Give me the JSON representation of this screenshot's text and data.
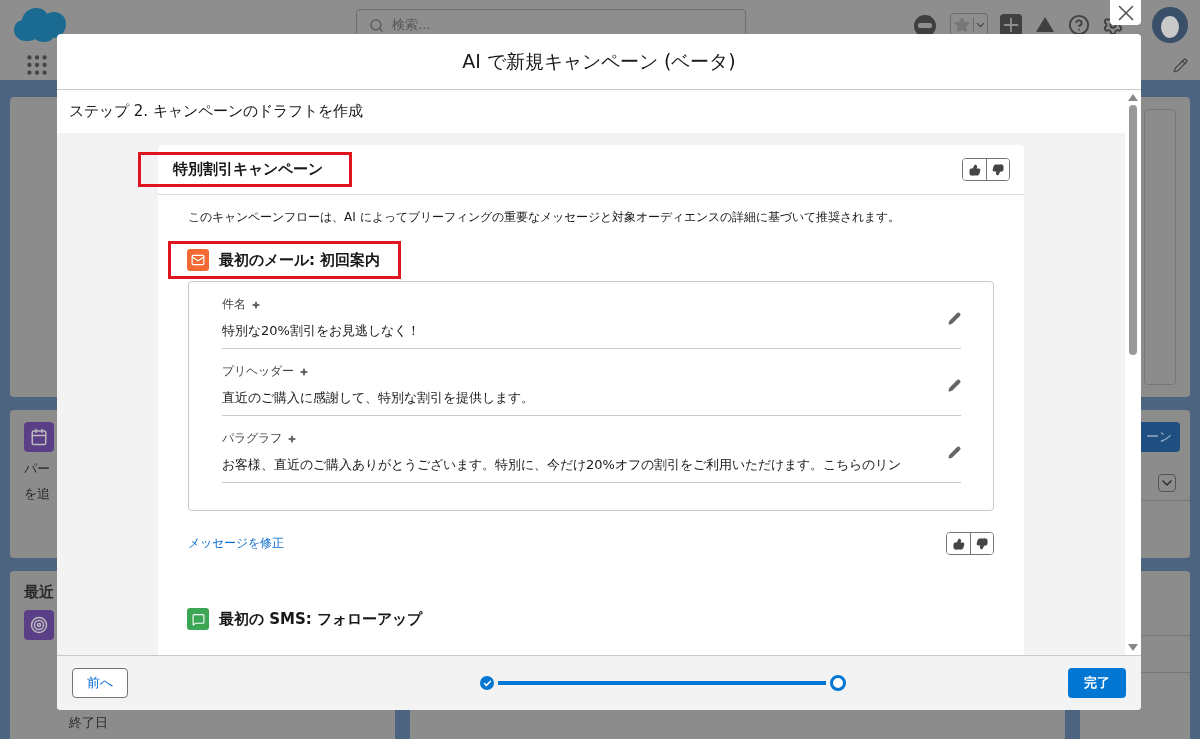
{
  "background": {
    "search": {
      "placeholder": "検索..."
    },
    "left_cards": [
      {
        "kind": "empty"
      },
      {
        "kind": "text",
        "lines": [
          "パー",
          "を追"
        ]
      },
      {
        "kind": "list",
        "title": "最近",
        "footer": "終了日"
      }
    ],
    "right_cards": [
      {
        "kind": "box"
      },
      {
        "kind": "button",
        "button": "ーン"
      },
      {
        "kind": "lines"
      }
    ]
  },
  "modal": {
    "title": "AI で新規キャンペーン (ベータ)",
    "step": "ステップ 2. キャンペーンのドラフトを作成",
    "campaign": {
      "title": "特別割引キャンペーン",
      "highlighted": true,
      "description": "このキャンペーンフローは、AI によってブリーフィングの重要なメッセージと対象オーディエンスの詳細に基づいて推奨されます。",
      "messages": [
        {
          "kind": "email",
          "title": "最初のメール: 初回案内",
          "highlighted": true,
          "edit_link": "メッセージを修正",
          "fields": [
            {
              "label": "件名",
              "value": "特別な20%割引をお見逃しなく！"
            },
            {
              "label": "プリヘッダー",
              "value": "直近のご購入に感謝して、特別な割引を提供します。"
            },
            {
              "label": "パラグラフ",
              "value": "お客様、直近のご購入ありがとうございます。特別に、今だけ20%オフの割引をご利用いただけます。こちらのリン"
            }
          ]
        },
        {
          "kind": "sms",
          "title": "最初の SMS: フォローアップ",
          "highlighted": false
        }
      ]
    },
    "footer": {
      "back": "前へ",
      "finish": "完了",
      "steps": [
        {
          "done": true
        },
        {
          "done": false
        }
      ]
    }
  }
}
